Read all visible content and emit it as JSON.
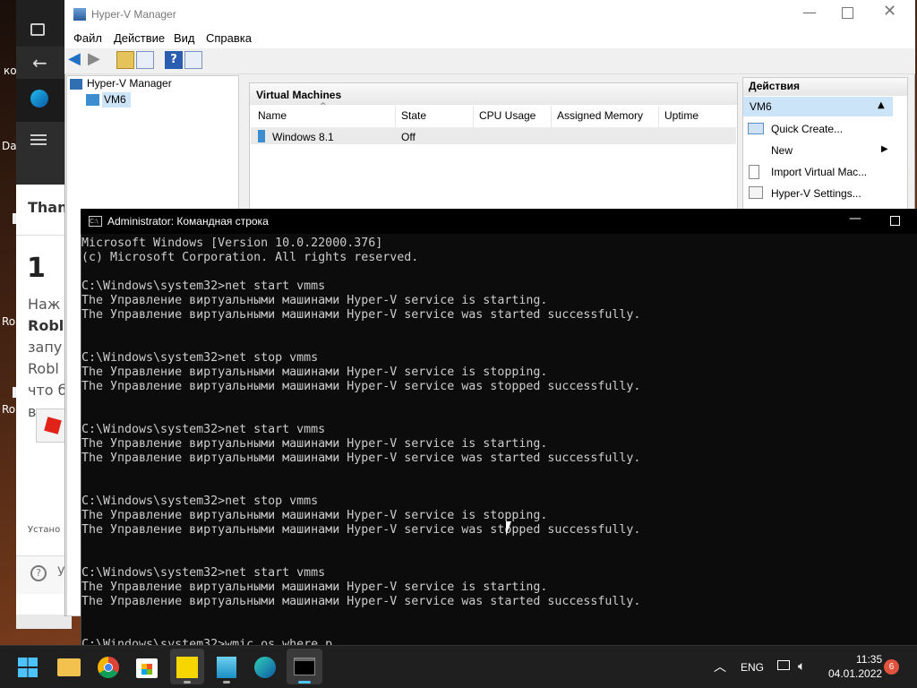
{
  "desktop": {
    "icons": [
      "ко",
      "Da",
      "Ro",
      "Ro"
    ]
  },
  "browser": {
    "page_title_fragment": "Than",
    "step_number": "1",
    "lines": [
      "Наж",
      "Robl",
      "запу",
      "Robl",
      "что б",
      "в"
    ],
    "footer_text": "Устано",
    "help_text": "У"
  },
  "hyperv": {
    "title": "Hyper-V Manager",
    "menu": [
      "Файл",
      "Действие",
      "Вид",
      "Справка"
    ],
    "tree_root": "Hyper-V Manager",
    "tree_child": "VM6",
    "vm_panel_title": "Virtual Machines",
    "columns": [
      "Name",
      "State",
      "CPU Usage",
      "Assigned Memory",
      "Uptime"
    ],
    "rows": [
      {
        "name": "Windows 8.1",
        "state": "Off",
        "cpu": "",
        "memory": "",
        "uptime": ""
      }
    ],
    "actions_title": "Действия",
    "actions_group": "VM6",
    "actions": [
      "Quick Create...",
      "New",
      "Import Virtual Mac...",
      "Hyper-V Settings..."
    ]
  },
  "cmd": {
    "title": "Administrator: Командная строка",
    "output": "Microsoft Windows [Version 10.0.22000.376]\n(c) Microsoft Corporation. All rights reserved.\n\nC:\\Windows\\system32>net start vmms\nThe Управление виртуальными машинами Hyper-V service is starting.\nThe Управление виртуальными машинами Hyper-V service was started successfully.\n\n\nC:\\Windows\\system32>net stop vmms\nThe Управление виртуальными машинами Hyper-V service is stopping.\nThe Управление виртуальными машинами Hyper-V service was stopped successfully.\n\n\nC:\\Windows\\system32>net start vmms\nThe Управление виртуальными машинами Hyper-V service is starting.\nThe Управление виртуальными машинами Hyper-V service was started successfully.\n\n\nC:\\Windows\\system32>net stop vmms\nThe Управление виртуальными машинами Hyper-V service is stopping.\nThe Управление виртуальными машинами Hyper-V service was stopped successfully.\n\n\nC:\\Windows\\system32>net start vmms\nThe Управление виртуальными машинами Hyper-V service is starting.\nThe Управление виртуальными машинами Hyper-V service was started successfully.\n\n\nC:\\Windows\\system32>wmic os where p"
  },
  "taskbar": {
    "icons": [
      "start-icon",
      "file-explorer-icon",
      "chrome-icon",
      "store-icon",
      "sticky-notes-icon",
      "hyperv-icon",
      "edge-icon",
      "terminal-icon"
    ],
    "language": "ENG",
    "time": "11:35",
    "date": "04.01.2022",
    "notification_count": "6"
  }
}
